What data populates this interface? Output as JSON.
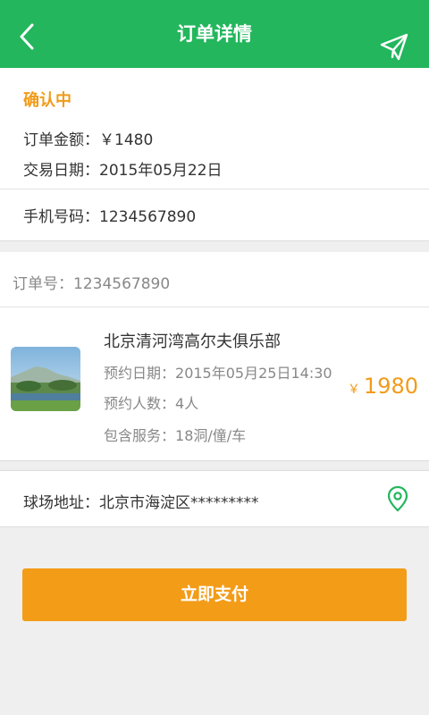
{
  "header": {
    "title": "订单详情",
    "back_icon": "chevron-left-icon",
    "send_icon": "paper-plane-icon",
    "color": "#23b65d"
  },
  "summary": {
    "status": "确认中",
    "amount_label": "订单金额：",
    "amount_value": "￥1480",
    "date_label": "交易日期：",
    "date_value": "2015年05月22日",
    "phone_label": "手机号码：",
    "phone_value": "1234567890"
  },
  "order": {
    "number_label": "订单号：",
    "number_value": "1234567890",
    "club_name": "北京清河湾高尔夫俱乐部",
    "booking_date_label": "预约日期：",
    "booking_date_value": "2015年05月25日14:30",
    "people_label": "预约人数：",
    "people_value": "4人",
    "service_label": "包含服务：",
    "service_value": "18洞/僮/车",
    "price_currency": "￥",
    "price_value": "1980",
    "thumbnail": "golf-course-thumbnail"
  },
  "address": {
    "label": "球场地址：",
    "value": "北京市海淀区*********",
    "pin_icon": "location-pin-icon"
  },
  "pay_button": {
    "label": "立即支付",
    "color": "#f39c18"
  },
  "accent_color": "#f19b1a"
}
